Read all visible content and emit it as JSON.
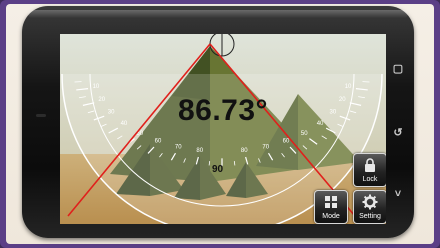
{
  "app": {
    "angle_readout": "86.73°",
    "center_tick_label": "90"
  },
  "protractor": {
    "tick_labels_left": [
      "10",
      "20",
      "30",
      "40",
      "50",
      "60",
      "70",
      "80"
    ],
    "tick_labels_right": [
      "10",
      "20",
      "30",
      "40",
      "50",
      "60",
      "70",
      "80"
    ]
  },
  "buttons": {
    "lock_label": "Lock",
    "mode_label": "Mode",
    "setting_label": "Setting"
  },
  "icons": {
    "lock": "lock-icon",
    "mode": "grid-icon",
    "setting": "gear-icon"
  },
  "colors": {
    "measurement_line": "#e0201c",
    "frame_purple": "#5b3f86"
  }
}
